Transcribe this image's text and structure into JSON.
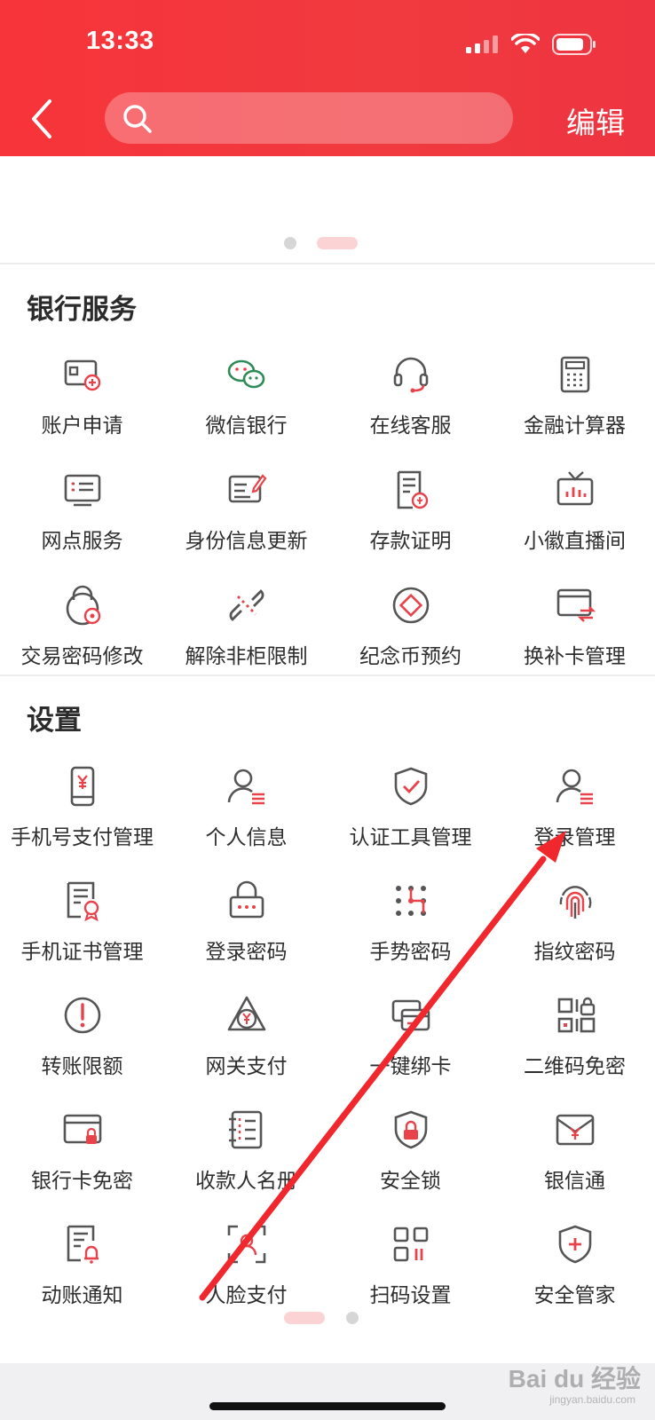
{
  "status_bar": {
    "time": "13:33"
  },
  "header": {
    "search_placeholder": "",
    "edit_label": "编辑"
  },
  "sections": [
    {
      "title": "银行服务",
      "items": [
        {
          "label": "账户申请",
          "icon": "account-apply-icon"
        },
        {
          "label": "微信银行",
          "icon": "wechat-icon"
        },
        {
          "label": "在线客服",
          "icon": "headset-icon"
        },
        {
          "label": "金融计算器",
          "icon": "calculator-icon"
        },
        {
          "label": "网点服务",
          "icon": "branch-list-icon"
        },
        {
          "label": "身份信息更新",
          "icon": "id-edit-icon"
        },
        {
          "label": "存款证明",
          "icon": "deposit-certificate-icon"
        },
        {
          "label": "小徽直播间",
          "icon": "tv-live-icon"
        },
        {
          "label": "交易密码修改",
          "icon": "lock-gear-icon"
        },
        {
          "label": "解除非柜限制",
          "icon": "unlink-icon"
        },
        {
          "label": "纪念币预约",
          "icon": "coin-icon"
        },
        {
          "label": "换补卡管理",
          "icon": "card-swap-icon"
        }
      ]
    },
    {
      "title": "设置",
      "items": [
        {
          "label": "手机号支付管理",
          "icon": "phone-pay-icon"
        },
        {
          "label": "个人信息",
          "icon": "person-info-icon"
        },
        {
          "label": "认证工具管理",
          "icon": "shield-check-icon"
        },
        {
          "label": "登录管理",
          "icon": "login-manage-icon"
        },
        {
          "label": "手机证书管理",
          "icon": "certificate-icon"
        },
        {
          "label": "登录密码",
          "icon": "password-lock-icon"
        },
        {
          "label": "手势密码",
          "icon": "gesture-icon"
        },
        {
          "label": "指纹密码",
          "icon": "fingerprint-icon"
        },
        {
          "label": "转账限额",
          "icon": "exclamation-icon"
        },
        {
          "label": "网关支付",
          "icon": "gateway-pay-icon"
        },
        {
          "label": "一键绑卡",
          "icon": "bind-card-icon"
        },
        {
          "label": "二维码免密",
          "icon": "qrcode-lock-icon"
        },
        {
          "label": "银行卡免密",
          "icon": "card-lock-icon"
        },
        {
          "label": "收款人名册",
          "icon": "payee-book-icon"
        },
        {
          "label": "安全锁",
          "icon": "shield-lock-icon"
        },
        {
          "label": "银信通",
          "icon": "envelope-yuan-icon"
        },
        {
          "label": "动账通知",
          "icon": "notice-bell-icon"
        },
        {
          "label": "人脸支付",
          "icon": "face-scan-icon"
        },
        {
          "label": "扫码设置",
          "icon": "scan-settings-icon"
        },
        {
          "label": "安全管家",
          "icon": "shield-plus-icon"
        }
      ]
    }
  ],
  "watermark": {
    "brand": "Bai du 经验",
    "url": "jingyan.baidu.com"
  },
  "colors": {
    "brand_red": "#f03a3f",
    "accent_red": "#e8434a",
    "icon_grey": "#555555"
  }
}
